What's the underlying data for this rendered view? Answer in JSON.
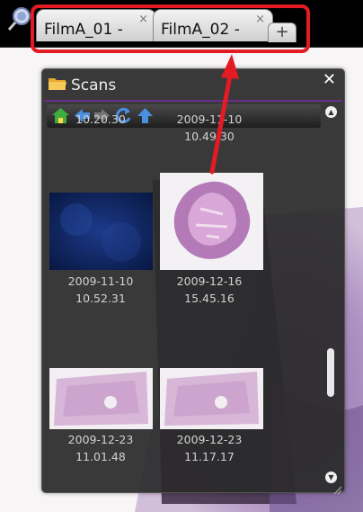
{
  "tabs": [
    {
      "label": "FilmA_01 -",
      "close": "×"
    },
    {
      "label": "FilmA_02 -",
      "close": "×"
    }
  ],
  "new_tab_label": "+",
  "panel": {
    "title": "Scans",
    "close": "✕",
    "scroll_up": "▲",
    "scroll_down": "▼"
  },
  "scans": [
    {
      "date": "",
      "time": "10.20.30"
    },
    {
      "date": "2009-11-10",
      "time": "10.49.30"
    },
    {
      "date": "2009-11-10",
      "time": "10.52.31"
    },
    {
      "date": "2009-12-16",
      "time": "15.45.16"
    },
    {
      "date": "2009-12-23",
      "time": "11.01.48"
    },
    {
      "date": "2009-12-23",
      "time": "11.17.17"
    }
  ],
  "colors": {
    "highlight": "#e31b23",
    "panel_bg": "#2a2a2a",
    "header_accent": "#6a2d8a",
    "toolbar_icon_home": "#3fae3f",
    "toolbar_icon_nav": "#4a8fe0"
  },
  "icons": [
    "app-icon",
    "folder-icon",
    "home-icon",
    "back-arrow-icon",
    "forward-arrow-icon",
    "refresh-icon",
    "up-arrow-icon",
    "close-icon",
    "resize-grip-icon"
  ]
}
